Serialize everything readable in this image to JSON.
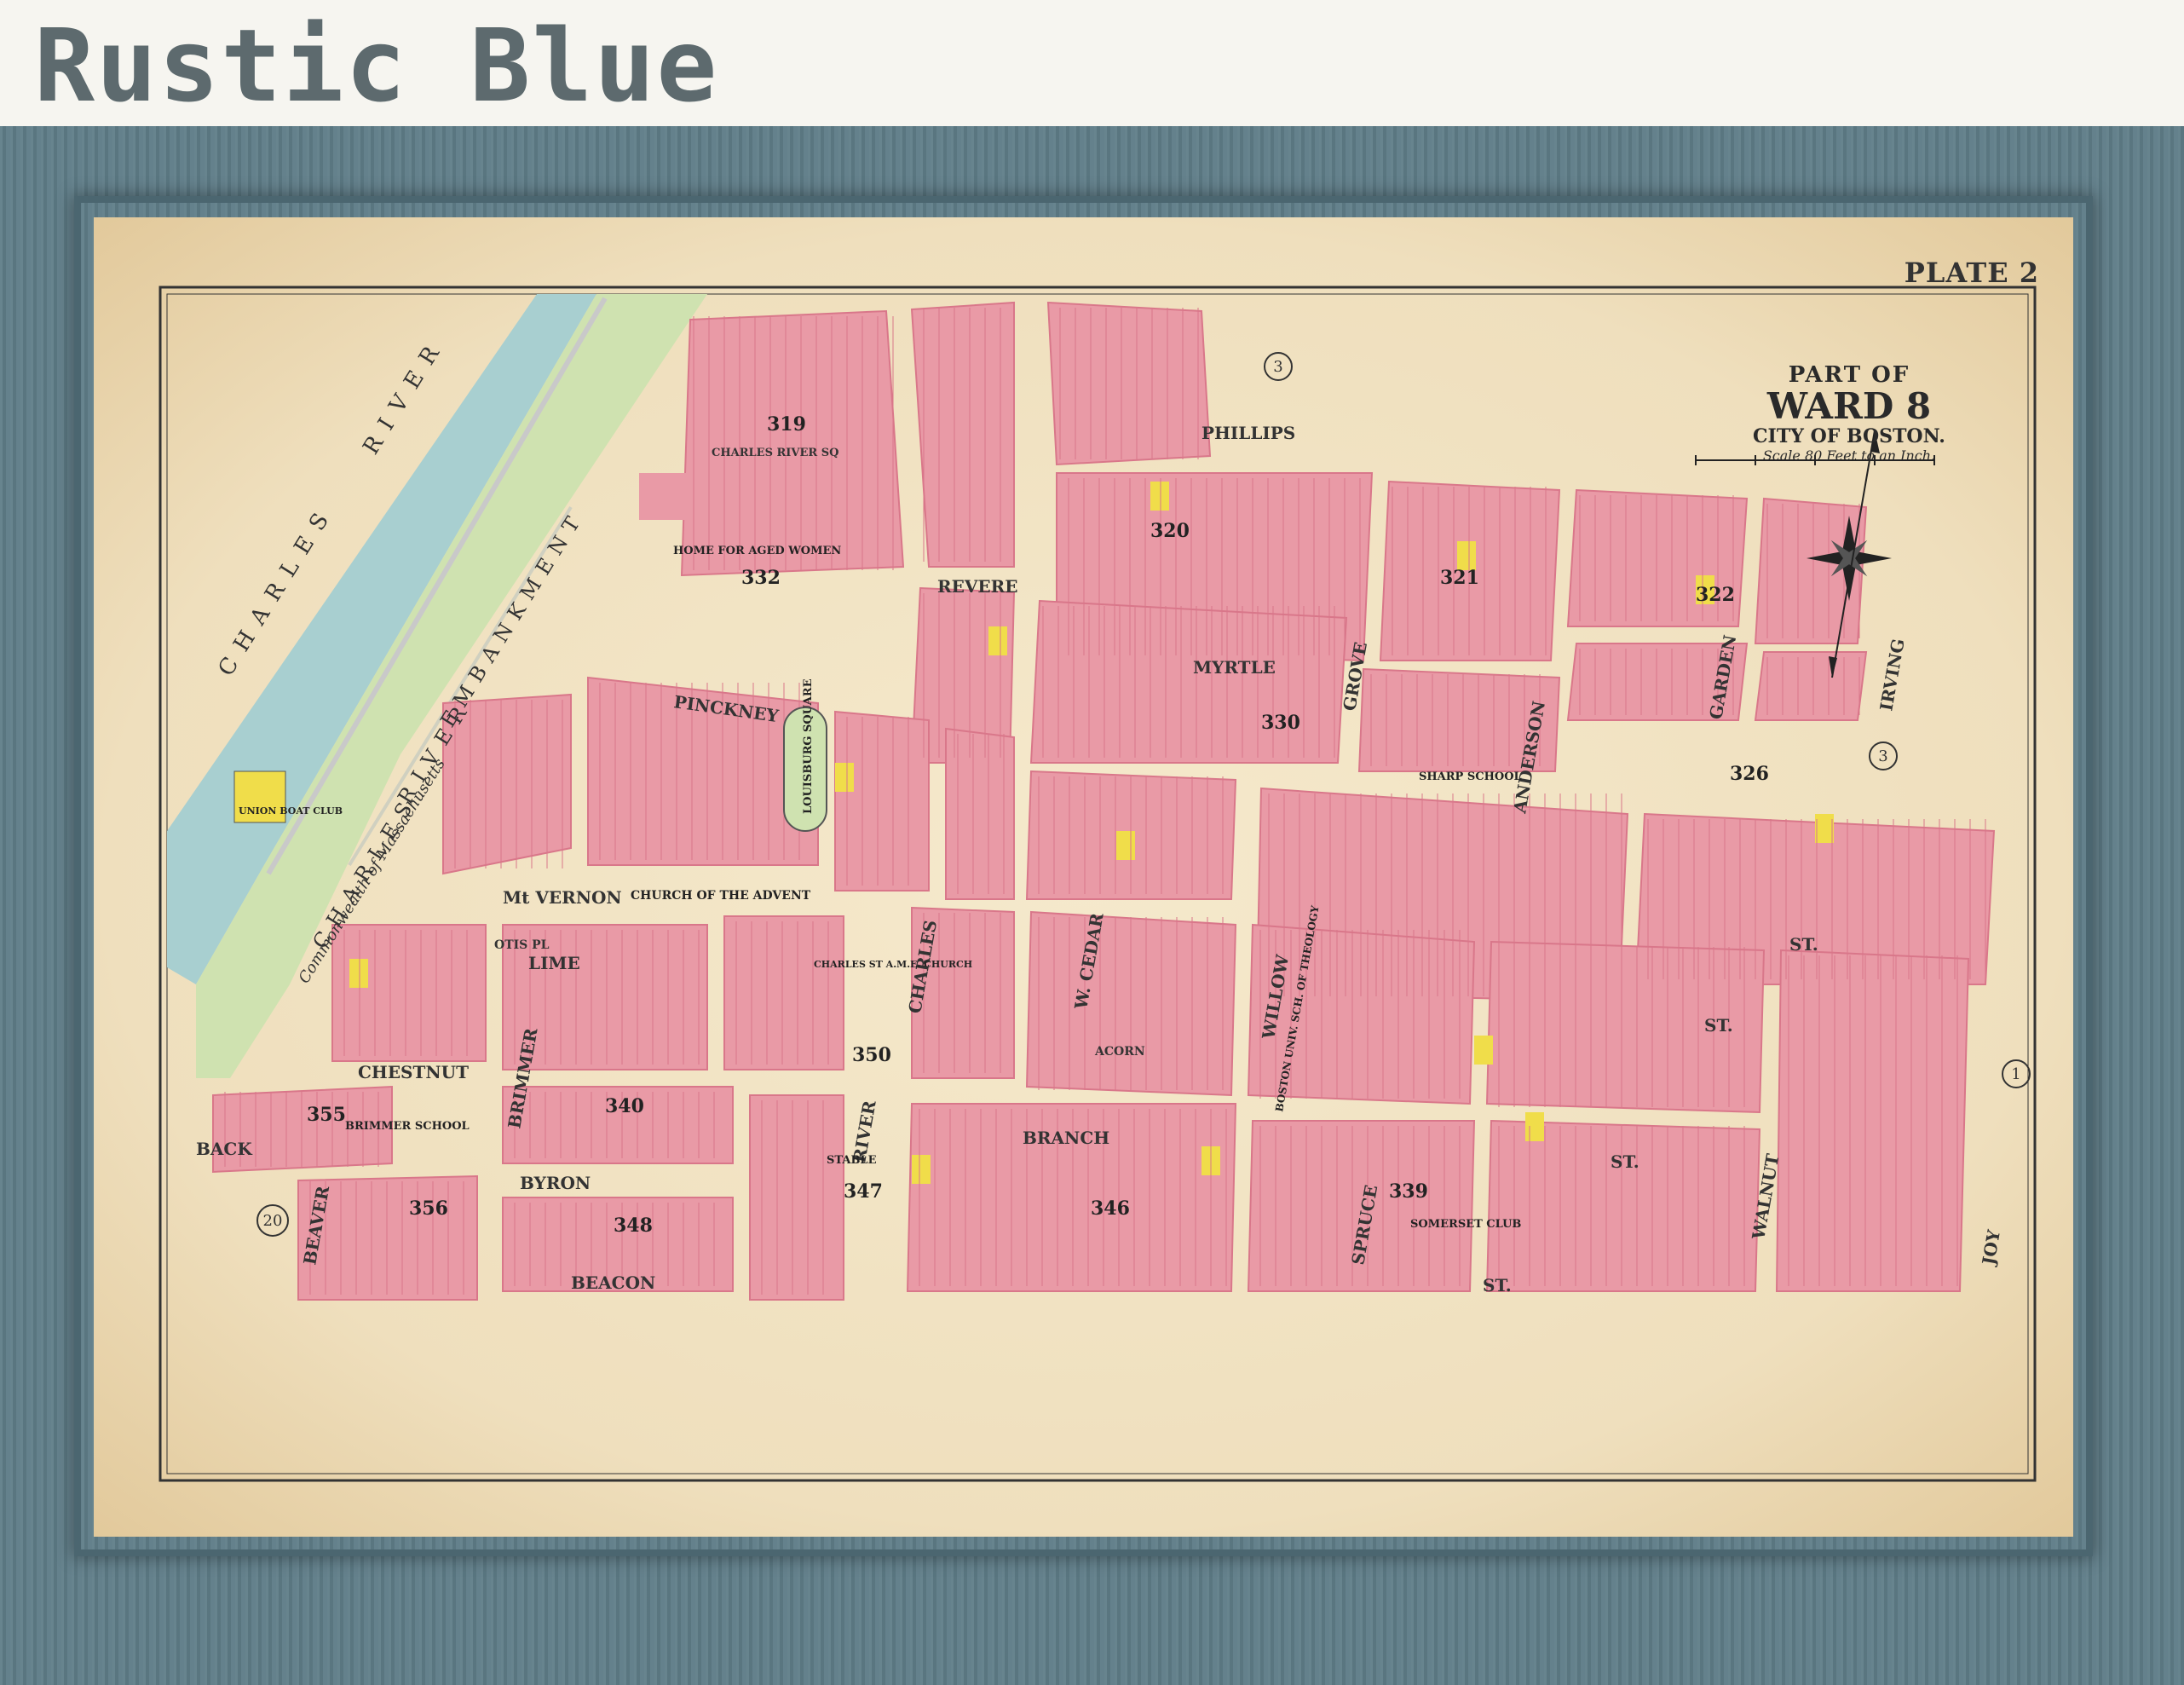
{
  "frame": {
    "title": "Rustic Blue",
    "color": "#5f7d88"
  },
  "map": {
    "plate": "PLATE 2",
    "title": {
      "line1": "PART OF",
      "line2": "WARD 8",
      "line3": "CITY OF BOSTON.",
      "scale": "Scale 80 Feet to an Inch."
    },
    "colors": {
      "brick": "#e99aa6",
      "brick_dark": "#d9778a",
      "wood": "#f0dd4a",
      "river": "#a8cfd0",
      "park": "#cfe2b0",
      "street": "#f1e3c3"
    },
    "water": [
      "CHARLES",
      "RIVER"
    ],
    "embankment": [
      "CHARLES",
      "RIVER",
      "EMBANKMENT"
    ],
    "commonwealth": "Commonwealth of Massachusetts",
    "streets": {
      "phillips": "PHILLIPS",
      "revere": "REVERE",
      "pinckney": "PINCKNEY",
      "myrtle": "MYRTLE",
      "mt_vernon": "Mt VERNON",
      "lime": "LIME",
      "chestnut": "CHESTNUT",
      "branch": "BRANCH",
      "back": "BACK",
      "byron": "BYRON",
      "beacon": "BEACON",
      "charles": "CHARLES",
      "w_cedar": "W. CEDAR",
      "willow": "WILLOW",
      "grove": "GROVE",
      "anderson": "ANDERSON",
      "garden": "GARDEN",
      "irving": "IRVING",
      "river_st": "RIVER",
      "brimmer": "BRIMMER",
      "beaver": "BEAVER",
      "spruce": "SPRUCE",
      "walnut": "WALNUT",
      "joy": "JOY",
      "otis_pl": "OTIS PL",
      "charles_river_sq": "CHARLES RIVER SQ",
      "acorn": "ACORN",
      "st": "ST."
    },
    "buildings": {
      "home_aged": "HOME FOR AGED WOMEN",
      "church_advent": "CHURCH OF THE ADVENT",
      "charles_st_church": "CHARLES ST A.M.E. CHURCH",
      "louisburg": "LOUISBURG SQUARE",
      "union_boat": "UNION BOAT CLUB",
      "sharp_school": "SHARP SCHOOL",
      "brimmer_school": "BRIMMER SCHOOL",
      "somerset": "SOMERSET CLUB",
      "boston_univ": "BOSTON UNIV. SCH. OF THEOLOGY",
      "stable": "STABLE"
    },
    "plate_numbers": {
      "p319": "319",
      "p332": "332",
      "p320": "320",
      "p321": "321",
      "p322": "322",
      "p330": "330",
      "p326": "326",
      "p340": "340",
      "p339": "339",
      "p346": "346",
      "p347": "347",
      "p348": "348",
      "p355": "355",
      "p356": "356",
      "p350": "350"
    },
    "circled": {
      "c3a": "3",
      "c3b": "3",
      "c1": "1",
      "c20": "20"
    }
  }
}
